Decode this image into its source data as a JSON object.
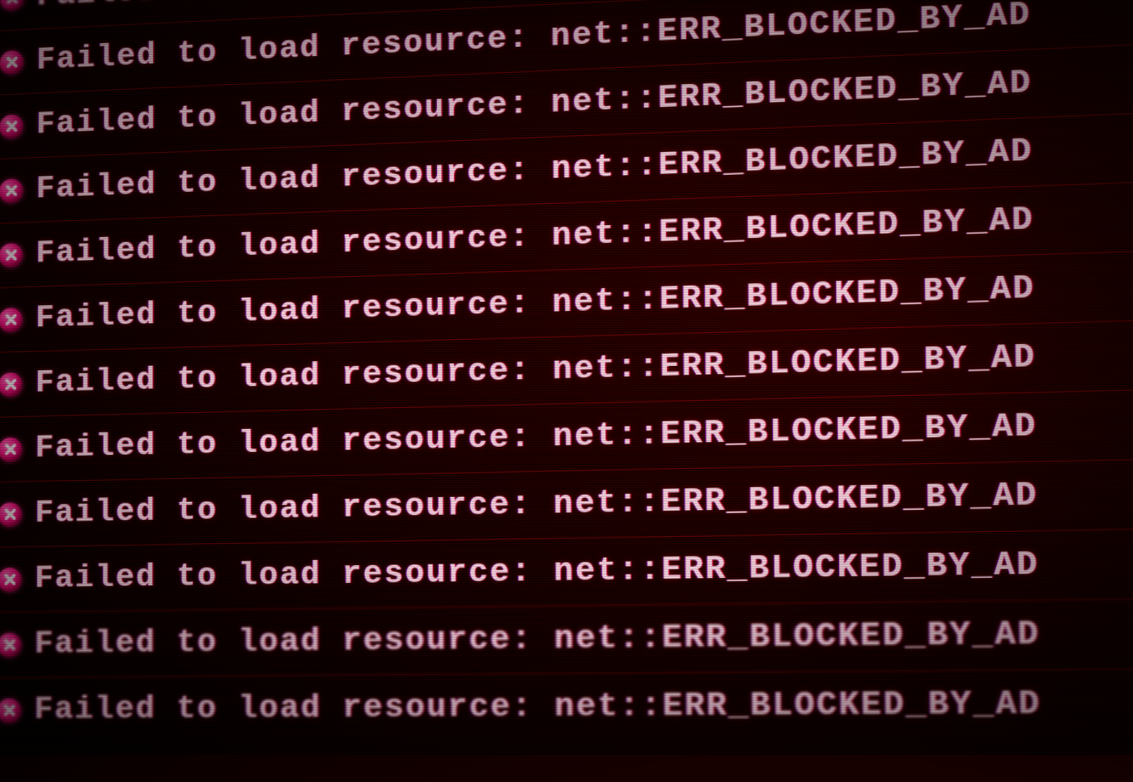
{
  "console": {
    "error_icon": "error-x",
    "lines": [
      {
        "text": "Failed to load resource: net::ERR_BLOCKED_BY_AD"
      },
      {
        "text": "Failed to load resource: net::ERR_BLOCKED_BY_AD"
      },
      {
        "text": "Failed to load resource: net::ERR_BLOCKED_BY_AD"
      },
      {
        "text": "Failed to load resource: net::ERR_BLOCKED_BY_AD"
      },
      {
        "text": "Failed to load resource: net::ERR_BLOCKED_BY_AD"
      },
      {
        "text": "Failed to load resource: net::ERR_BLOCKED_BY_AD"
      },
      {
        "text": "Failed to load resource: net::ERR_BLOCKED_BY_AD"
      },
      {
        "text": "Failed to load resource: net::ERR_BLOCKED_BY_AD"
      },
      {
        "text": "Failed to load resource: net::ERR_BLOCKED_BY_AD"
      },
      {
        "text": "Failed to load resource: net::ERR_BLOCKED_BY_AD"
      },
      {
        "text": "Failed to load resource: net::ERR_BLOCKED_BY_AD"
      },
      {
        "text": "Failed to load resource: net::ERR_BLOCKED_BY_AD"
      }
    ]
  }
}
